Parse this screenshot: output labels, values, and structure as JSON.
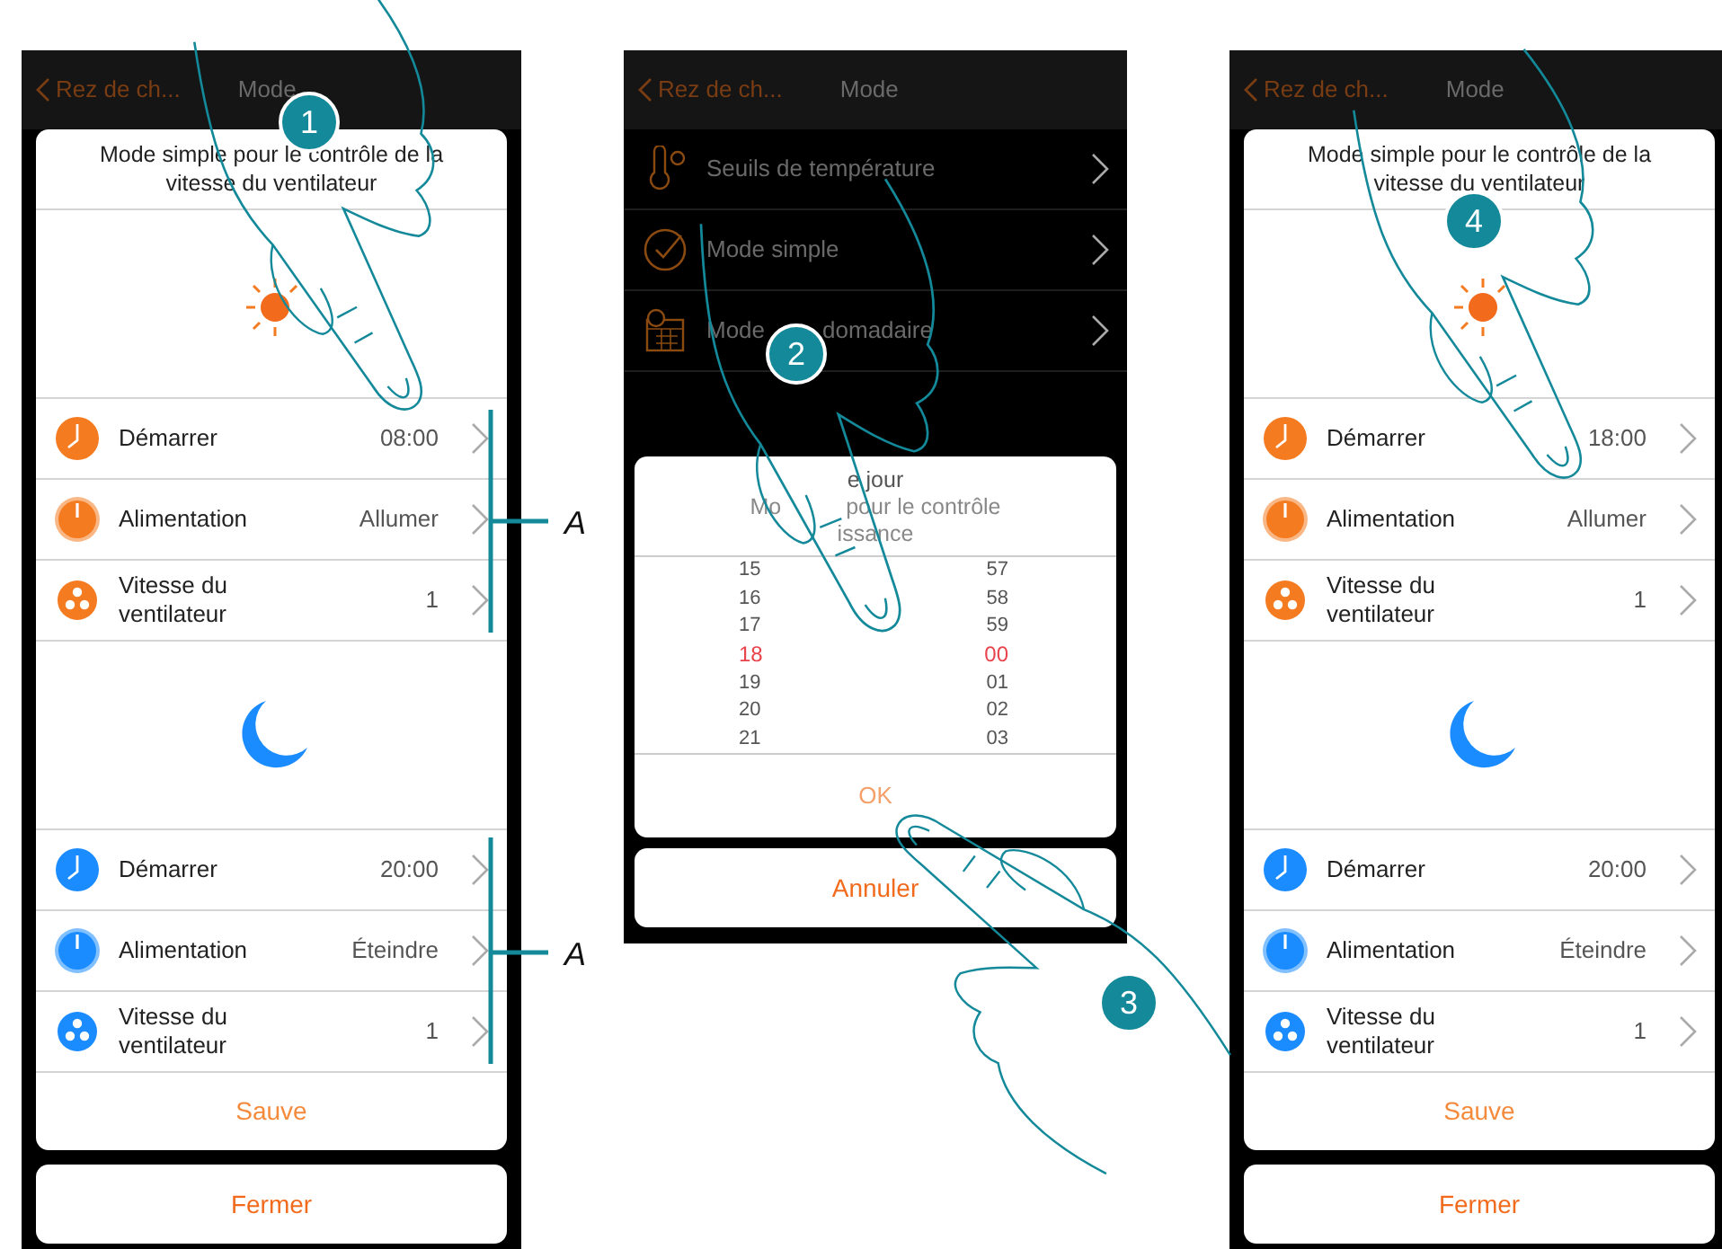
{
  "screens": [
    {
      "kind": "editor",
      "header": {
        "back": "Rez de ch...",
        "title": "Mode"
      },
      "title": "Mode simple pour le contrôle de la vitesse du ventilateur",
      "sections": [
        {
          "kind": "day",
          "rows": [
            {
              "kind": "clock",
              "label": "Démarrer",
              "value": "08:00"
            },
            {
              "kind": "power",
              "label": "Alimentation",
              "value": "Allumer"
            },
            {
              "kind": "fan",
              "label": "Vitesse du ventilateur",
              "value": "1"
            }
          ]
        },
        {
          "kind": "night",
          "rows": [
            {
              "kind": "clock",
              "label": "Démarrer",
              "value": "20:00"
            },
            {
              "kind": "power",
              "label": "Alimentation",
              "value": "Éteindre"
            },
            {
              "kind": "fan",
              "label": "Vitesse du ventilateur",
              "value": "1"
            }
          ]
        }
      ],
      "save": "Sauve",
      "close": "Fermer"
    },
    {
      "kind": "picker",
      "header": {
        "back": "Rez de ch...",
        "title": "Mode"
      },
      "items": [
        {
          "kind": "thermometer",
          "label_parts": [
            "Seuils de  température"
          ]
        },
        {
          "kind": "check",
          "label_parts": [
            "Mode simple"
          ]
        },
        {
          "kind": "calendar",
          "label_parts": [
            "Mode",
            "domadaire"
          ]
        }
      ],
      "dialog": {
        "title_parts": [
          "e jour"
        ],
        "subtitle_lines": [
          [
            "Mo",
            "pour le contrôle"
          ],
          [
            "issance"
          ]
        ],
        "rows": [
          {
            "hour": "15",
            "minute": "57",
            "selected": false
          },
          {
            "hour": "16",
            "minute": "58",
            "selected": false
          },
          {
            "hour": "17",
            "minute": "59",
            "selected": false
          },
          {
            "hour": "18",
            "minute": "00",
            "selected": true
          },
          {
            "hour": "19",
            "minute": "01",
            "selected": false
          },
          {
            "hour": "20",
            "minute": "02",
            "selected": false
          },
          {
            "hour": "21",
            "minute": "03",
            "selected": false
          }
        ],
        "ok": "OK"
      },
      "cancel": "Annuler"
    },
    {
      "kind": "editor",
      "header": {
        "back": "Rez de ch...",
        "title": "Mode"
      },
      "title": "Mode simple pour le contrôle de la vitesse du ventilateur",
      "sections": [
        {
          "kind": "day",
          "rows": [
            {
              "kind": "clock",
              "label": "Démarrer",
              "value": "18:00"
            },
            {
              "kind": "power",
              "label": "Alimentation",
              "value": "Allumer"
            },
            {
              "kind": "fan",
              "label": "Vitesse du ventilateur",
              "value": "1"
            }
          ]
        },
        {
          "kind": "night",
          "rows": [
            {
              "kind": "clock",
              "label": "Démarrer",
              "value": "20:00"
            },
            {
              "kind": "power",
              "label": "Alimentation",
              "value": "Éteindre"
            },
            {
              "kind": "fan",
              "label": "Vitesse du ventilateur",
              "value": "1"
            }
          ]
        }
      ],
      "save": "Sauve",
      "close": "Fermer"
    }
  ],
  "callouts": [
    {
      "label": "A"
    },
    {
      "label": "A"
    }
  ],
  "steps": [
    "1",
    "2",
    "3",
    "4"
  ]
}
